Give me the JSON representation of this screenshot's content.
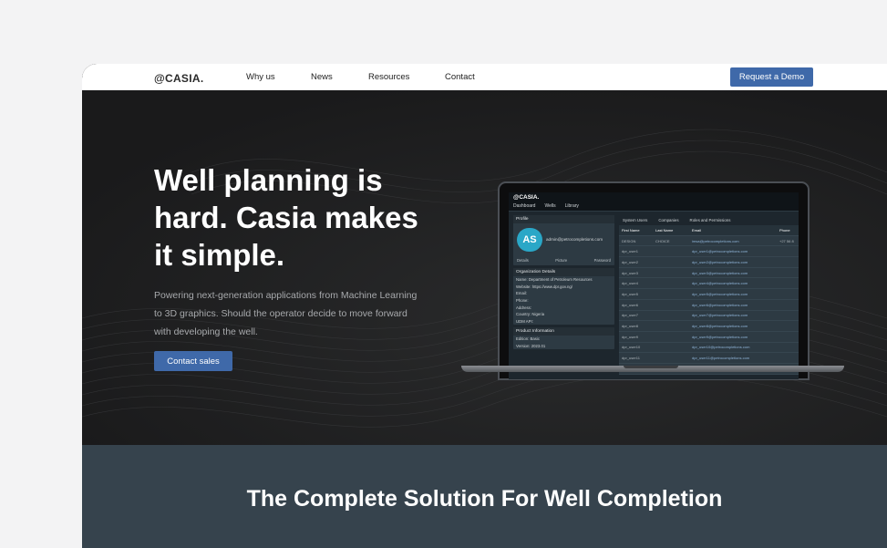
{
  "nav": {
    "logo": "@CASIA.",
    "links": [
      "Why us",
      "News",
      "Resources",
      "Contact"
    ],
    "cta": "Request a Demo"
  },
  "hero": {
    "headline": "Well planning is hard. Casia makes it simple.",
    "subtext": "Powering next-generation applications from Machine Learning to 3D graphics. Should the operator decide to move forward with developing the well.",
    "button": "Contact sales"
  },
  "screen": {
    "logo": "@CASIA.",
    "tabs": [
      "Dashboard",
      "Wells",
      "Library"
    ],
    "profile_label": "Profile",
    "avatar_text": "AS",
    "email": "admin@petrocompletions.com",
    "profile_actions": [
      "Details",
      "Picture",
      "Password"
    ],
    "org_label": "Organization Details",
    "org_rows": [
      "Name: Department of Petroleum Resources",
      "Website: https://www.dpr.gov.ng/",
      "Email:",
      "Phone:",
      "Address:",
      "Country: Nigeria",
      "UDM API:"
    ],
    "product_label": "Product Information",
    "product_rows": [
      "Edition: Basic",
      "Version: 2023.01"
    ],
    "right_tabs": [
      "System Users",
      "Companies",
      "Roles and Permissions"
    ],
    "table_headers": [
      "First Name",
      "Last Name",
      "Email",
      "Phone"
    ],
    "table_rows": [
      [
        "DESIGN",
        "CHOICE",
        "imsa@petrocompletions.com",
        "+27 56 8"
      ],
      [
        "dpr_user1",
        "",
        "dpr_user1@petrocompletions.com",
        ""
      ],
      [
        "dpr_user2",
        "",
        "dpr_user2@petrocompletions.com",
        ""
      ],
      [
        "dpr_user3",
        "",
        "dpr_user3@petrocompletions.com",
        ""
      ],
      [
        "dpr_user4",
        "",
        "dpr_user4@petrocompletions.com",
        ""
      ],
      [
        "dpr_user5",
        "",
        "dpr_user5@petrocompletions.com",
        ""
      ],
      [
        "dpr_user6",
        "",
        "dpr_user6@petrocompletions.com",
        ""
      ],
      [
        "dpr_user7",
        "",
        "dpr_user7@petrocompletions.com",
        ""
      ],
      [
        "dpr_user8",
        "",
        "dpr_user8@petrocompletions.com",
        ""
      ],
      [
        "dpr_user9",
        "",
        "dpr_user9@petrocompletions.com",
        ""
      ],
      [
        "dpr_user10",
        "",
        "dpr_user10@petrocompletions.com",
        ""
      ],
      [
        "dpr_user11",
        "",
        "dpr_user11@petrocompletions.com",
        ""
      ],
      [
        "dpr_user12",
        "",
        "dpr_user12@petrocompletions.com",
        ""
      ]
    ]
  },
  "section2": {
    "title": "The Complete Solution For Well Completion"
  },
  "colors": {
    "accent": "#3f69a9",
    "hero_bg": "#1c1c1d",
    "section_bg": "#36434d"
  }
}
